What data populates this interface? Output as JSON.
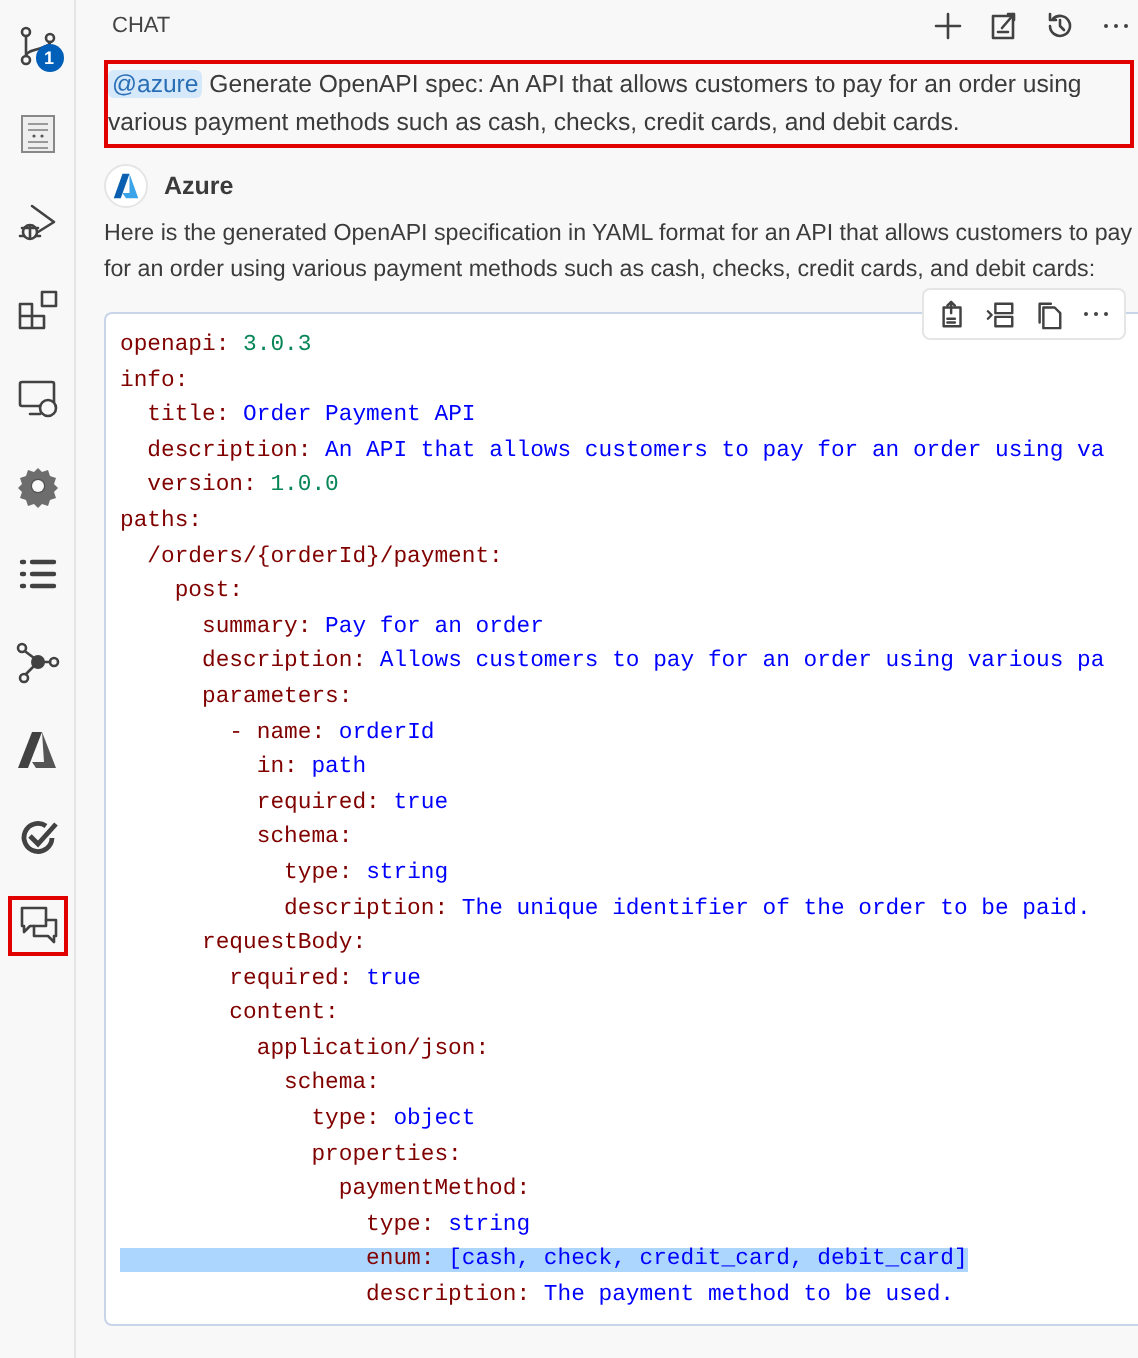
{
  "activity_bar": {
    "items": [
      {
        "badge": "1",
        "selected": false
      },
      {
        "selected": false
      },
      {
        "selected": false
      },
      {
        "selected": false
      },
      {
        "selected": false
      },
      {
        "selected": false
      },
      {
        "selected": false
      },
      {
        "selected": false
      },
      {
        "selected": false
      },
      {
        "selected": false
      },
      {
        "selected": true
      }
    ]
  },
  "panel": {
    "title": "CHAT"
  },
  "request": {
    "mention": "@azure",
    "text": "Generate OpenAPI spec: An API that allows customers to pay for an order using various payment methods such as cash, checks, credit cards, and debit cards.",
    "highlighted": true
  },
  "response": {
    "author": "Azure",
    "intro": "Here is the generated OpenAPI specification in YAML format for an API that allows customers to pay for an order using various payment methods such as cash, checks, credit cards, and debit cards:",
    "code_lines": [
      {
        "key": "openapi:",
        "value": "3.0.3",
        "kind": "number",
        "highlighted": false
      },
      {
        "key": "info:",
        "highlighted": false
      },
      {
        "key": "  title:",
        "value": "Order Payment API",
        "kind": "text",
        "highlighted": false
      },
      {
        "key": "  description:",
        "value": "An API that allows customers to pay for an order using va",
        "kind": "text",
        "highlighted": false
      },
      {
        "key": "  version:",
        "value": "1.0.0",
        "kind": "number",
        "highlighted": false
      },
      {
        "key": "paths:",
        "highlighted": false
      },
      {
        "key": "  /orders/{orderId}/payment:",
        "highlighted": false
      },
      {
        "key": "    post:",
        "highlighted": false
      },
      {
        "key": "      summary:",
        "value": "Pay for an order",
        "kind": "text",
        "highlighted": false
      },
      {
        "key": "      description:",
        "value": "Allows customers to pay for an order using various pa",
        "kind": "text",
        "highlighted": false
      },
      {
        "key": "      parameters:",
        "highlighted": false
      },
      {
        "key": "        - name:",
        "value": "orderId",
        "kind": "text",
        "highlighted": false
      },
      {
        "key": "          in:",
        "value": "path",
        "kind": "text",
        "highlighted": false
      },
      {
        "key": "          required:",
        "value": "true",
        "kind": "text",
        "highlighted": false
      },
      {
        "key": "          schema:",
        "highlighted": false
      },
      {
        "key": "            type:",
        "value": "string",
        "kind": "text",
        "highlighted": false
      },
      {
        "key": "            description:",
        "value": "The unique identifier of the order to be paid.",
        "kind": "text",
        "highlighted": false
      },
      {
        "key": "      requestBody:",
        "highlighted": false
      },
      {
        "key": "        required:",
        "value": "true",
        "kind": "text",
        "highlighted": false
      },
      {
        "key": "        content:",
        "highlighted": false
      },
      {
        "key": "          application/json:",
        "highlighted": false
      },
      {
        "key": "            schema:",
        "highlighted": false
      },
      {
        "key": "              type:",
        "value": "object",
        "kind": "text",
        "highlighted": false
      },
      {
        "key": "              properties:",
        "highlighted": false
      },
      {
        "key": "                paymentMethod:",
        "highlighted": false
      },
      {
        "key": "                  type:",
        "value": "string",
        "kind": "text",
        "highlighted": false
      },
      {
        "key": "                  enum:",
        "value": "[cash, check, credit_card, debit_card]",
        "kind": "text",
        "highlighted": true
      },
      {
        "key": "                  description:",
        "value": "The payment method to be used.",
        "kind": "text",
        "highlighted": false
      }
    ]
  }
}
